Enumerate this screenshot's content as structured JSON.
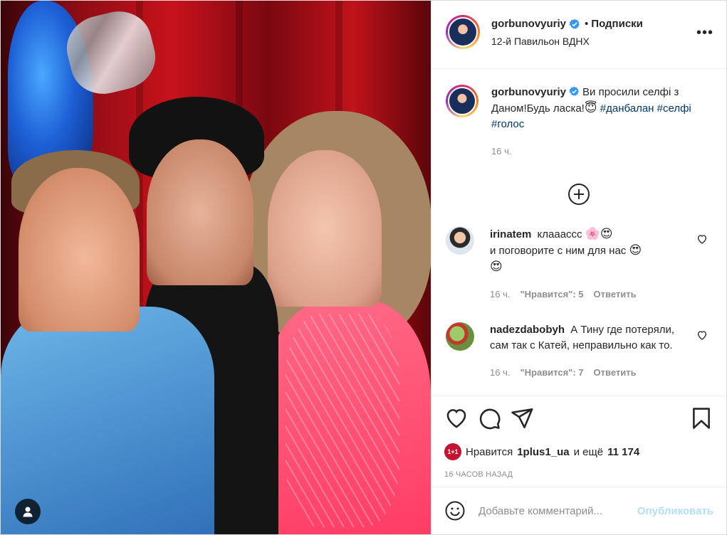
{
  "header": {
    "username": "gorbunovyuriy",
    "separator": "•",
    "follow_label": "Подписки",
    "location": "12-й Павильон ВДНХ",
    "more_label": "•••"
  },
  "caption": {
    "username": "gorbunovyuriy",
    "text": "Ви просили селфі з Даном!Будь ласка!",
    "emoji": "😇",
    "hashtags": [
      "#данбалан",
      "#селфі",
      "#голос"
    ],
    "time": "16 ч."
  },
  "comments": [
    {
      "username": "irinatem",
      "text_line1": "клаааccс",
      "emoji1": "🌸",
      "emoji2": "😍",
      "text_line2": "и поговорите с ним для нас",
      "emoji3": "😍",
      "emoji4": "😍",
      "time": "16 ч.",
      "likes": "\"Нравится\": 5",
      "reply_label": "Ответить"
    },
    {
      "username": "nadezdabobyh",
      "text": "А Тину где потеряли, сам так с Катей, неправильно как то.",
      "time": "16 ч.",
      "likes": "\"Нравится\": 7",
      "reply_label": "Ответить"
    }
  ],
  "likes": {
    "avatar_text": "1+1",
    "prefix": "Нравится",
    "user": "1plus1_ua",
    "middle": "и ещё",
    "count": "11 174"
  },
  "timestamp": "16 ЧАСОВ НАЗАД",
  "add_comment": {
    "placeholder": "Добавьте комментарий...",
    "post_label": "Опубликовать"
  },
  "colors": {
    "link": "#00376b",
    "verified": "#3897f0",
    "post_button": "#b2dffc",
    "muted": "#8e8e8e"
  }
}
